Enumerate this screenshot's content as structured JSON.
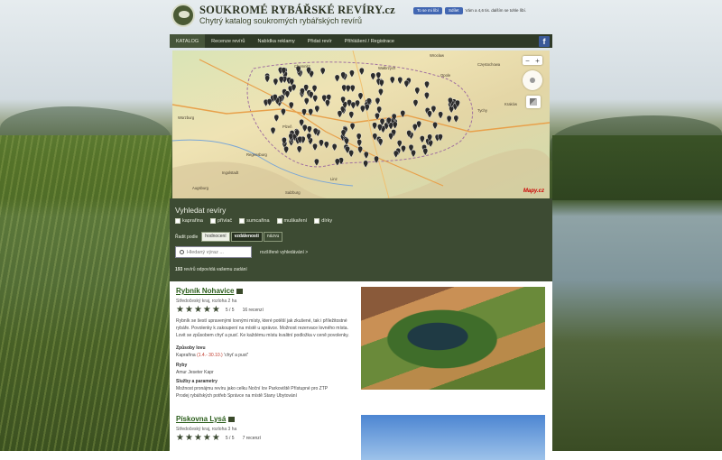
{
  "header": {
    "title": "SOUKROMÉ RYBÁŘSKÉ REVÍRY.cz",
    "subtitle": "Chytrý katalog soukromých rybářských revírů",
    "fb_like_label": "To se mi líbí",
    "fb_share_label": "Sdílet",
    "fb_like_text": "Vám a 4,6 tis. dalším se tohle líbí."
  },
  "nav": {
    "items": [
      {
        "label": "KATALOG",
        "active": true
      },
      {
        "label": "Recenze revírů"
      },
      {
        "label": "Nabídka reklamy"
      },
      {
        "label": "Přidat revír"
      },
      {
        "label": "Přihlášení / Registrace"
      }
    ],
    "fb_glyph": "f"
  },
  "map": {
    "zoom_in": "+",
    "zoom_out": "−",
    "provider": "Mapy.cz",
    "cities": [
      {
        "name": "Wrocław"
      },
      {
        "name": "Chemnitz"
      },
      {
        "name": "Wałbrzych"
      },
      {
        "name": "Częstochowa"
      },
      {
        "name": "Opole"
      },
      {
        "name": "Würzburg"
      },
      {
        "name": "Plzeň"
      },
      {
        "name": "Regensburg"
      },
      {
        "name": "Augsburg"
      },
      {
        "name": "Ingolstadt"
      },
      {
        "name": "Kraków"
      },
      {
        "name": "Tychy"
      },
      {
        "name": "Salzburg"
      },
      {
        "name": "Linz"
      }
    ]
  },
  "search": {
    "title": "Vyhledat revíry",
    "species": [
      "kaprařina",
      "přívlač",
      "sumcařina",
      "muškaření",
      "dírky"
    ],
    "sort_label": "Řadit podle",
    "sort_options": [
      "hodnocení",
      "vzdálenosti",
      "názvu"
    ],
    "placeholder": "Hledaný výraz ...",
    "advanced_link": "rozšířené vyhledávání >",
    "count": "193",
    "count_suffix": "revírů odpovídá vašemu zadání"
  },
  "listings": [
    {
      "name": "Rybník Nohavice",
      "meta": "Středočeský kraj, rozloha 2 ha",
      "rating": "5 / 5",
      "reviews": "16 recenzí",
      "desc": "Rybník se šestí upravenými lovnými místy, které potěší jak zkušené, tak i příležitostné rybáře. Povolenky k zakoupení na místě u správce. Možnost rezervace lovného místa. Lovit se způsobem chyť a pusť. Ke každému místu kvalitní podložka v ceně povolenky.",
      "sec_lov": "Způsoby lovu",
      "lov_name": "Kaprařina",
      "lov_price": "(1.4.- 30.10.)",
      "lov_extra": "'chyť a pusť'",
      "sec_ryby": "Ryby",
      "ryby": "Amur   Jeseter   Kapr",
      "sec_sluzby": "Služby a parametry",
      "sluzby1": "Možnost pronájmu revíru jako celku   Noční lov   Parkoviště   Přístupné pro ZTP",
      "sluzby2": "Prodej rybářských potřeb   Správce na místě   Stany   Ubytování"
    },
    {
      "name": "Pískovna Lysá",
      "meta": "Středočeský kraj, rozloha 3 ha",
      "rating": "5 / 5",
      "reviews": "7 recenzí"
    }
  ]
}
